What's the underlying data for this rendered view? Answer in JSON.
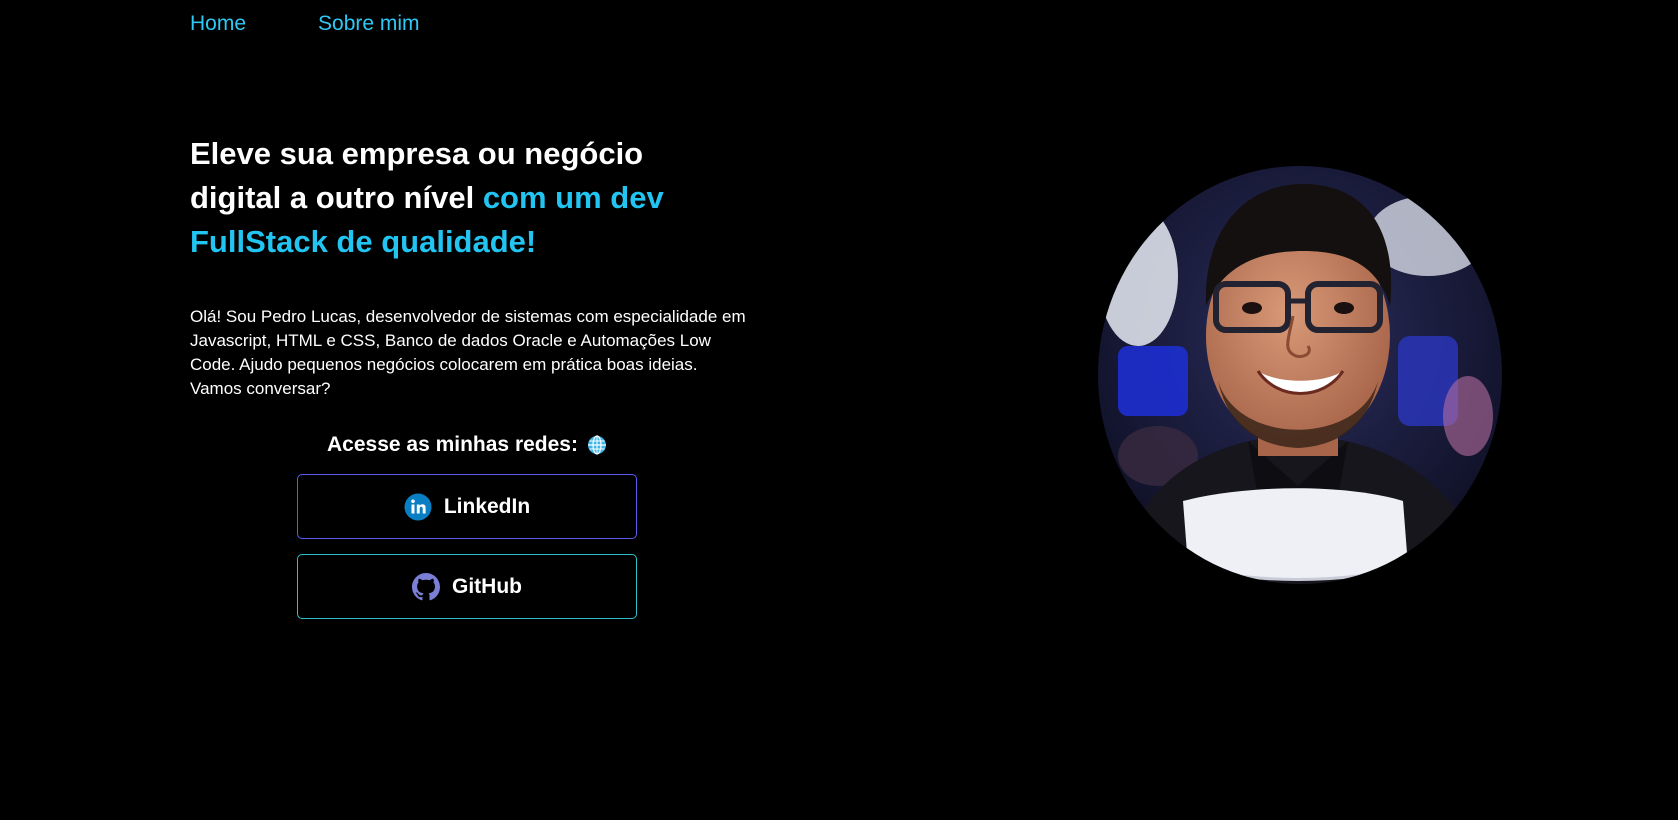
{
  "nav": {
    "home": "Home",
    "about": "Sobre mim"
  },
  "hero": {
    "title_plain": "Eleve sua empresa ou negócio digital a outro nível ",
    "title_accent": "com um dev FullStack de qualidade!",
    "intro": "Olá! Sou Pedro Lucas, desenvolvedor de sistemas com especialidade em Javascript, HTML e CSS, Banco de dados Oracle e Automações Low Code. Ajudo pequenos negócios colocarem em prática boas ideias. Vamos conversar?"
  },
  "networks": {
    "heading": "Acesse as minhas redes:",
    "heading_icon": "globe-icon",
    "linkedin_label": "LinkedIn",
    "linkedin_icon": "linkedin-icon",
    "github_label": "GitHub",
    "github_icon": "github-icon"
  },
  "colors": {
    "background": "#000000",
    "accent": "#22c4f2",
    "text": "#ffffff",
    "linkedin_border": "#5a5cf0",
    "github_border": "#2cc0c8"
  },
  "photo": {
    "icon": "profile-photo"
  }
}
